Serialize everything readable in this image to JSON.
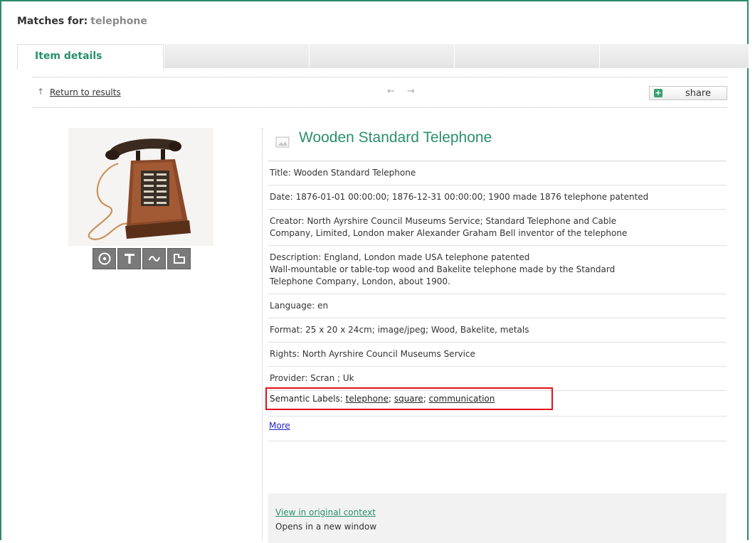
{
  "header": {
    "matches_label": "Matches for:",
    "query": "telephone"
  },
  "tabs": [
    {
      "label": "Item details",
      "active": true
    },
    {
      "label": ""
    },
    {
      "label": ""
    },
    {
      "label": ""
    },
    {
      "label": ""
    }
  ],
  "nav": {
    "return_label": "Return to results",
    "up_icon": "arrow-up-icon",
    "prev_icon": "←",
    "next_icon": "→",
    "share_label": "share"
  },
  "item": {
    "title": "Wooden Standard Telephone",
    "fields": [
      {
        "label": "Title:",
        "value": "Wooden Standard Telephone"
      },
      {
        "label": "Date:",
        "value": "1876-01-01 00:00:00;  1876-12-31 00:00:00;  1900 made 1876 telephone patented"
      },
      {
        "label": "Creator:",
        "value": "North Ayrshire Council Museums Service;  Standard Telephone and Cable\nCompany, Limited, London maker Alexander Graham Bell inventor of the telephone"
      },
      {
        "label": "Description:",
        "value": "England, London made USA telephone patented\nWall-mountable or table-top wood and Bakelite telephone made by the Standard\nTelephone Company, London, about 1900."
      },
      {
        "label": "Language:",
        "value": "en"
      },
      {
        "label": "Format:",
        "value": "25 x 20 x 24cm;  image/jpeg;  Wood, Bakelite, metals"
      },
      {
        "label": "Rights:",
        "value": "North Ayrshire Council Museums Service"
      },
      {
        "label": "Provider:",
        "value": "Scran ;  Uk"
      }
    ],
    "semantic": {
      "label": "Semantic Labels:",
      "tags": [
        "telephone",
        "square",
        "communication"
      ]
    },
    "more_label": "More"
  },
  "context": {
    "link_label": "View in original context",
    "note": "Opens in a new window"
  },
  "colors": {
    "accent": "#2a8f6c",
    "frame": "#2f8a6a",
    "highlight": "#e0101a",
    "link": "#1f1fcc"
  }
}
